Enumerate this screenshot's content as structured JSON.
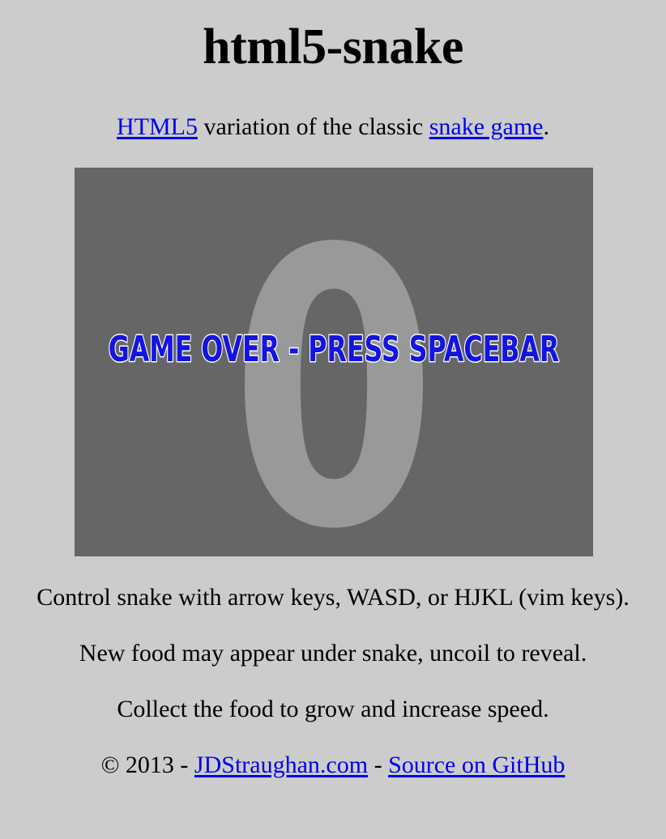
{
  "page": {
    "title": "html5-snake",
    "intro": {
      "link_html5": "HTML5",
      "text_middle": " variation of the classic ",
      "link_snake_game": "snake game",
      "text_end": "."
    }
  },
  "game": {
    "score": "0",
    "message": "GAME OVER - PRESS SPACEBAR",
    "colors": {
      "background": "#666666",
      "score_digit": "#999999",
      "message_fill": "#0000ee",
      "message_outline": "#ffffff"
    }
  },
  "instructions": [
    "Control snake with arrow keys, WASD, or HJKL (vim keys).",
    "New food may appear under snake, uncoil to reveal.",
    "Collect the food to grow and increase speed."
  ],
  "footer": {
    "copyright": "© 2013 - ",
    "link_site": "JDStraughan.com",
    "separator": " - ",
    "link_source": "Source on GitHub"
  },
  "colors": {
    "page_background": "#cccccc",
    "link": "#0000ee"
  }
}
